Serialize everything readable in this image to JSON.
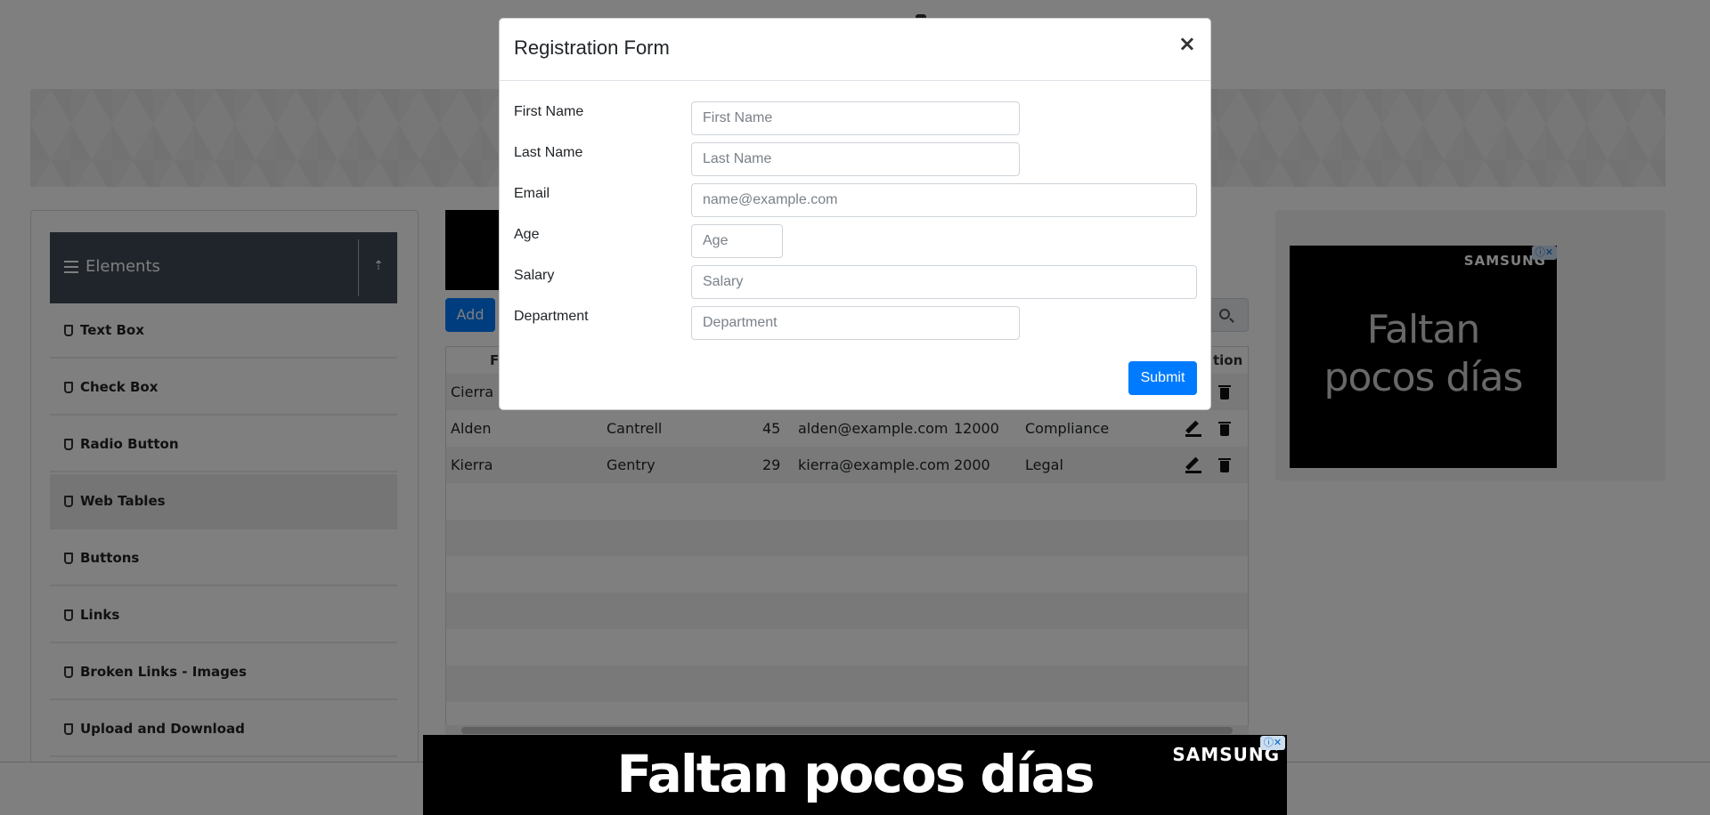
{
  "sidebar": {
    "group_title": "Elements",
    "items": [
      {
        "label": "Text Box"
      },
      {
        "label": "Check Box"
      },
      {
        "label": "Radio Button"
      },
      {
        "label": "Web Tables"
      },
      {
        "label": "Buttons"
      },
      {
        "label": "Links"
      },
      {
        "label": "Broken Links - Images"
      },
      {
        "label": "Upload and Download"
      }
    ]
  },
  "toolbar": {
    "add_label": "Add"
  },
  "table": {
    "headers_visible": {
      "first": "Fi",
      "action": "tion"
    },
    "rows": [
      {
        "first": "Cierra",
        "last": "",
        "age": "",
        "email": "",
        "salary": "",
        "department": ""
      },
      {
        "first": "Alden",
        "last": "Cantrell",
        "age": "45",
        "email": "alden@example.com",
        "salary": "12000",
        "department": "Compliance"
      },
      {
        "first": "Kierra",
        "last": "Gentry",
        "age": "29",
        "email": "kierra@example.com",
        "salary": "2000",
        "department": "Legal"
      }
    ]
  },
  "right_ad": {
    "brand": "SAMSUNG",
    "headline_line1": "Faltan",
    "headline_line2": "pocos días",
    "adchoice": "ⓘ✕"
  },
  "bottom_ad": {
    "headline": "Faltan pocos días",
    "brand": "SAMSUNG",
    "adchoice": "ⓘ✕"
  },
  "modal": {
    "title": "Registration Form",
    "close": "×",
    "fields": {
      "first_name": {
        "label": "First Name",
        "placeholder": "First Name",
        "value": ""
      },
      "last_name": {
        "label": "Last Name",
        "placeholder": "Last Name",
        "value": ""
      },
      "email": {
        "label": "Email",
        "placeholder": "name@example.com",
        "value": ""
      },
      "age": {
        "label": "Age",
        "placeholder": "Age",
        "value": ""
      },
      "salary": {
        "label": "Salary",
        "placeholder": "Salary",
        "value": ""
      },
      "department": {
        "label": "Department",
        "placeholder": "Department",
        "value": ""
      }
    },
    "submit_label": "Submit"
  },
  "colors": {
    "primary": "#007bff",
    "sidebar_header": "#3e4a57",
    "overlay": "rgba(0,0,0,0.5)"
  }
}
